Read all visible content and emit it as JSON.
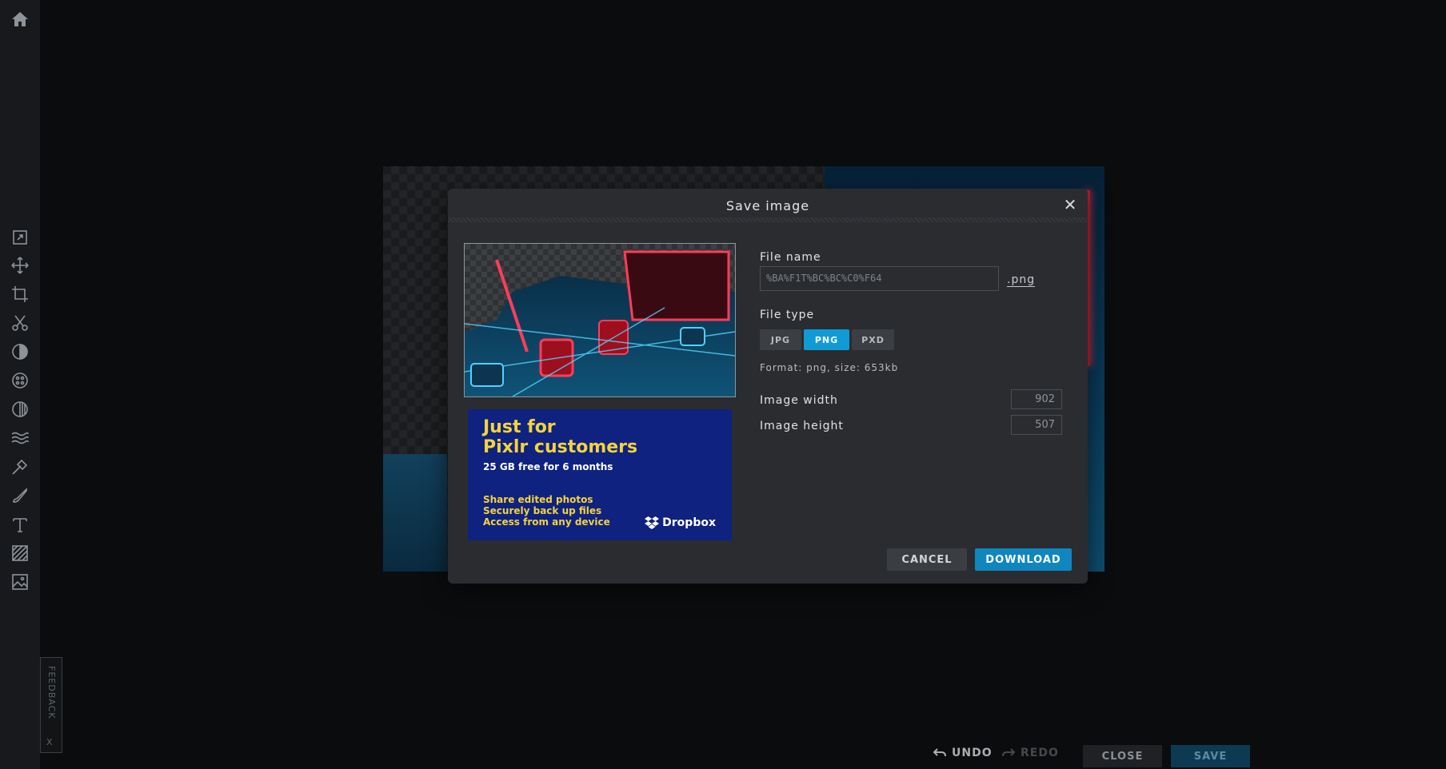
{
  "dialog": {
    "title": "Save image",
    "file_name_label": "File name",
    "file_name_value": "%BA%F1T%BC%BC%C0%F64",
    "file_extension": ".png",
    "file_type_label": "File type",
    "file_types": [
      "JPG",
      "PNG",
      "PXD"
    ],
    "selected_type": "PNG",
    "format_text": "Format: png, size: 653kb",
    "width_label": "Image width",
    "width_value": "902",
    "height_label": "Image height",
    "height_value": "507",
    "cancel_label": "CANCEL",
    "download_label": "DOWNLOAD"
  },
  "ad": {
    "headline_line1": "Just for",
    "headline_line2": "Pixlr customers",
    "subline": "25 GB free for 6 months",
    "bullets": [
      "Share edited photos",
      "Securely back up files",
      "Access from any device"
    ],
    "brand": "Dropbox"
  },
  "sidebar": {
    "tools": [
      "home-icon",
      "arrange-icon",
      "move-icon",
      "crop-icon",
      "cutout-icon",
      "adjust-icon",
      "filter-icon",
      "effect-icon",
      "liquify-icon",
      "retouch-icon",
      "draw-icon",
      "text-icon",
      "pattern-icon",
      "add-image-icon"
    ]
  },
  "feedback": {
    "label": "FEEDBACK",
    "close": "X"
  },
  "bottom_bar": {
    "undo_label": "UNDO",
    "redo_label": "REDO",
    "close_label": "CLOSE",
    "save_label": "SAVE"
  },
  "colors": {
    "accent": "#119bd5",
    "download_button": "#0f86be",
    "modal_bg": "#2a2c30",
    "ad_bg": "#0f2280",
    "ad_headline": "#f4d33c"
  }
}
